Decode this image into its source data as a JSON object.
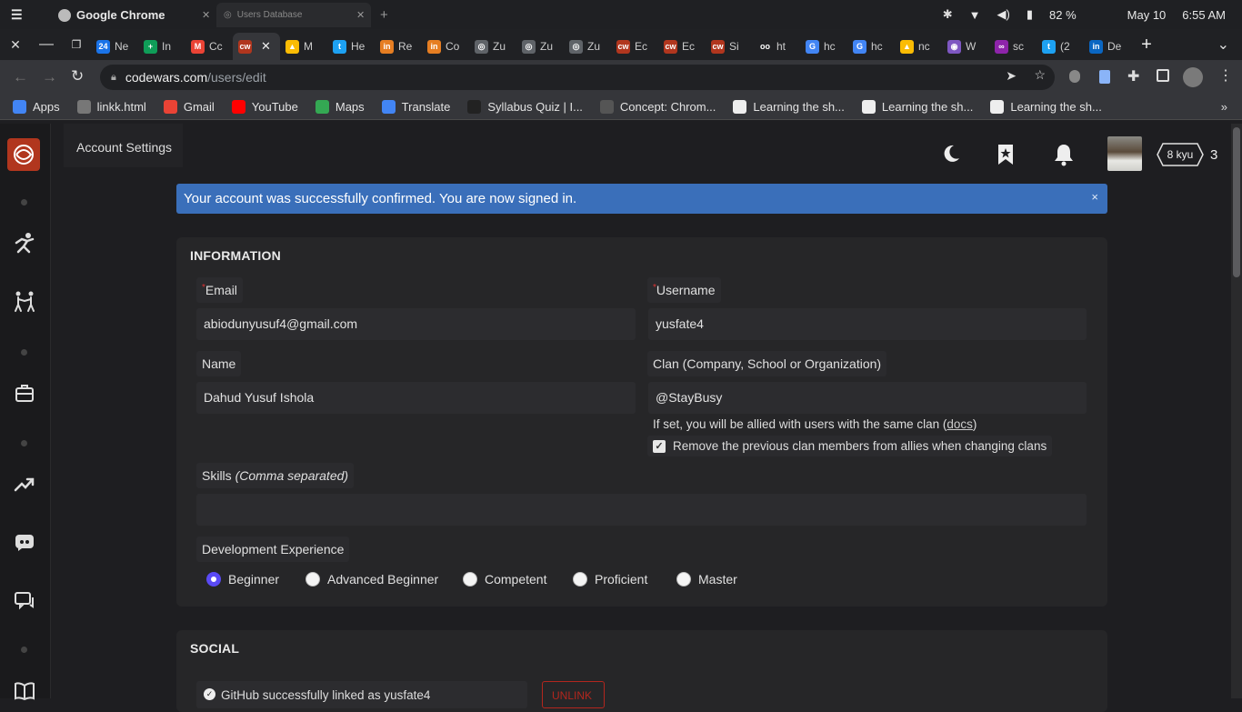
{
  "system_bar": {
    "app_name": "Google Chrome",
    "other_window_title": "Users Database",
    "battery": "82 %",
    "date": "May 10",
    "time": "6:55 AM"
  },
  "tabs": [
    {
      "favicon": "24",
      "title": "Ne",
      "color": "#1a73e8"
    },
    {
      "favicon": "+",
      "title": "In",
      "color": "#0f9d58"
    },
    {
      "favicon": "M",
      "title": "Cc",
      "color": "#ea4335"
    },
    {
      "favicon": "cw",
      "title": "",
      "color": "#b1361e",
      "active": true
    },
    {
      "favicon": "▲",
      "title": "M",
      "color": "#fbbc04"
    },
    {
      "favicon": "t",
      "title": "He",
      "color": "#1da1f2"
    },
    {
      "favicon": "in",
      "title": "Re",
      "color": "#e67e22"
    },
    {
      "favicon": "in",
      "title": "Co",
      "color": "#e67e22"
    },
    {
      "favicon": "◎",
      "title": "Zu",
      "color": "#5f6368"
    },
    {
      "favicon": "◎",
      "title": "Zu",
      "color": "#5f6368"
    },
    {
      "favicon": "◎",
      "title": "Zu",
      "color": "#5f6368"
    },
    {
      "favicon": "cw",
      "title": "Ec",
      "color": "#b1361e"
    },
    {
      "favicon": "cw",
      "title": "Ec",
      "color": "#b1361e"
    },
    {
      "favicon": "cw",
      "title": "Si",
      "color": "#b1361e"
    },
    {
      "favicon": "oo",
      "title": "ht",
      "color": "#202124"
    },
    {
      "favicon": "G",
      "title": "hc",
      "color": "#4285f4"
    },
    {
      "favicon": "G",
      "title": "hc",
      "color": "#4285f4"
    },
    {
      "favicon": "▲",
      "title": "nc",
      "color": "#fbbc04"
    },
    {
      "favicon": "◉",
      "title": "W",
      "color": "#7e57c2"
    },
    {
      "favicon": "∞",
      "title": "sc",
      "color": "#8e24aa"
    },
    {
      "favicon": "t",
      "title": "(2",
      "color": "#1da1f2"
    },
    {
      "favicon": "in",
      "title": "De",
      "color": "#0a66c2"
    }
  ],
  "address": {
    "host": "codewars.com",
    "path": "/users/edit"
  },
  "bookmarks": [
    {
      "label": "Apps",
      "color": "#4285f4"
    },
    {
      "label": "linkk.html",
      "color": "#777"
    },
    {
      "label": "Gmail",
      "color": "#ea4335"
    },
    {
      "label": "YouTube",
      "color": "#ff0000"
    },
    {
      "label": "Maps",
      "color": "#34a853"
    },
    {
      "label": "Translate",
      "color": "#4285f4"
    },
    {
      "label": "Syllabus Quiz | I...",
      "color": "#222"
    },
    {
      "label": "Concept: Chrom...",
      "color": "#555"
    },
    {
      "label": "Learning the sh...",
      "color": "#eee"
    },
    {
      "label": "Learning the sh...",
      "color": "#eee"
    },
    {
      "label": "Learning the sh...",
      "color": "#eee"
    }
  ],
  "header": {
    "account_settings": "Account Settings",
    "rank": "8 kyu",
    "honor": "3"
  },
  "banner": {
    "message": "Your account was successfully confirmed. You are now signed in.",
    "close": "×"
  },
  "information": {
    "title": "INFORMATION",
    "email_label": "Email",
    "email_value": "abiodunyusuf4@gmail.com",
    "username_label": "Username",
    "username_value": "yusfate4",
    "name_label": "Name",
    "name_value": "Dahud Yusuf Ishola",
    "clan_label": "Clan (Company, School or Organization)",
    "clan_value": "@StayBusy",
    "clan_hint_pre": "If set, you will be allied with users with the same clan (",
    "clan_hint_link": "docs",
    "clan_hint_post": ")",
    "remove_allies_label": "Remove the previous clan members from allies when changing clans",
    "remove_allies_checked": true,
    "skills_label": "Skills",
    "skills_hint": "(Comma separated)",
    "skills_value": "",
    "dev_exp_label": "Development Experience",
    "dev_exp_options": [
      "Beginner",
      "Advanced Beginner",
      "Competent",
      "Proficient",
      "Master"
    ],
    "dev_exp_selected": "Beginner"
  },
  "social": {
    "title": "SOCIAL",
    "github_status": "GitHub successfully linked as yusfate4",
    "unlink": "UNLINK"
  }
}
